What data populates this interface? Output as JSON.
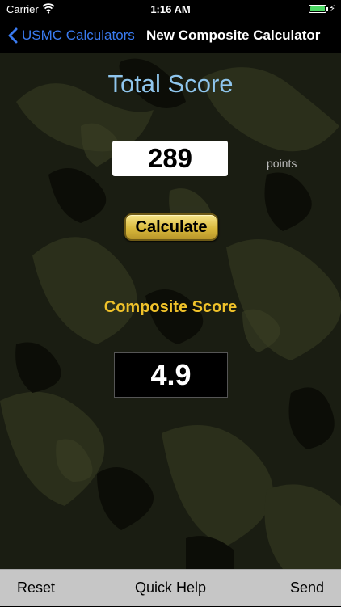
{
  "status_bar": {
    "carrier": "Carrier",
    "time": "1:16 AM",
    "battery_level": 1.0
  },
  "nav": {
    "back_label": "USMC Calculators",
    "title": "New Composite Calculator"
  },
  "main": {
    "total_label": "Total Score",
    "total_value": "289",
    "points_label": "points",
    "calculate_label": "Calculate",
    "composite_label": "Composite Score",
    "composite_value": "4.9"
  },
  "toolbar": {
    "reset_label": "Reset",
    "help_label": "Quick Help",
    "send_label": "Send"
  },
  "colors": {
    "back_tint": "#3a7bf0",
    "total_label": "#8fc6ee",
    "composite_label": "#f0c22a",
    "battery": "#4cd964",
    "toolbar_bg": "#c6c6c6"
  },
  "icons": {
    "back": "chevron-left-icon",
    "wifi": "wifi-icon",
    "battery": "battery-icon",
    "charging": "bolt-icon"
  }
}
